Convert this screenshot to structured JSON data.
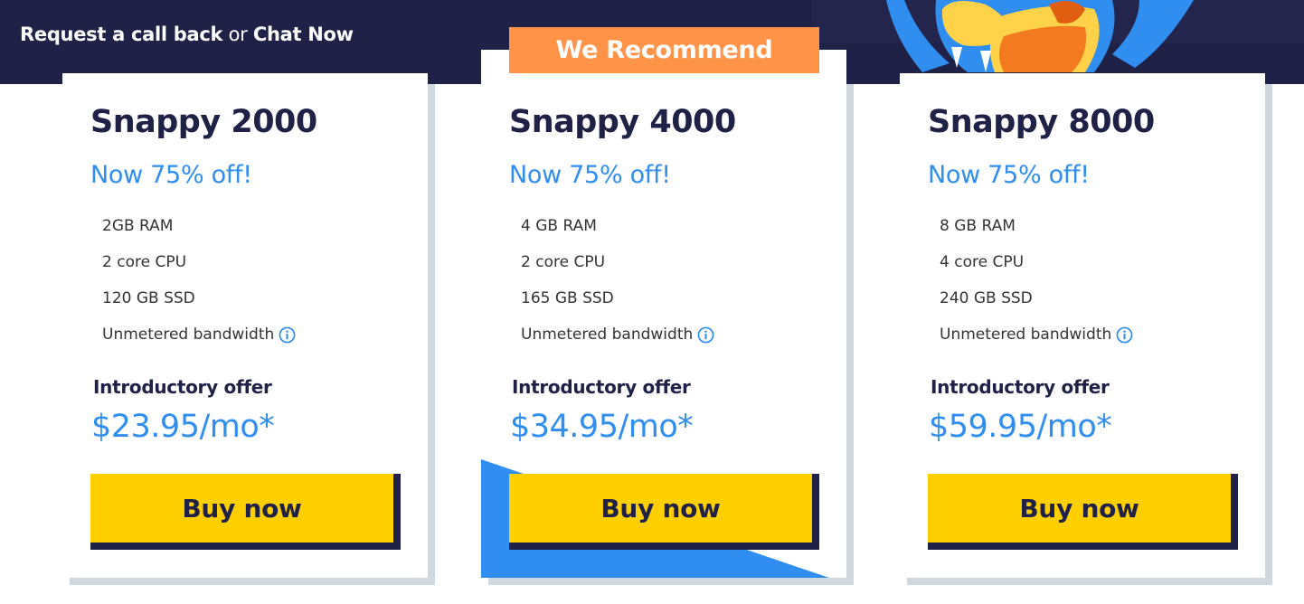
{
  "header": {
    "callback_label": "Request a call back",
    "or_label": "or",
    "chat_label": "Chat Now"
  },
  "recommend_badge": "We Recommend",
  "plans": [
    {
      "title": "Snappy 2000",
      "discount": "Now 75% off!",
      "features": [
        "2GB RAM",
        "2 core CPU",
        "120 GB SSD",
        "Unmetered bandwidth"
      ],
      "intro_label": "Introductory offer",
      "price": "$23.95/mo*",
      "button_label": "Buy now"
    },
    {
      "title": "Snappy 4000",
      "discount": "Now 75% off!",
      "features": [
        "4 GB RAM",
        "2 core CPU",
        "165 GB SSD",
        "Unmetered bandwidth"
      ],
      "intro_label": "Introductory offer",
      "price": "$34.95/mo*",
      "button_label": "Buy now"
    },
    {
      "title": "Snappy 8000",
      "discount": "Now 75% off!",
      "features": [
        "8 GB RAM",
        "4 core CPU",
        "240 GB SSD",
        "Unmetered bandwidth"
      ],
      "intro_label": "Introductory offer",
      "price": "$59.95/mo*",
      "button_label": "Buy now"
    }
  ],
  "icons": {
    "info": "info-circle-icon",
    "mascot": "gator-mascot"
  },
  "colors": {
    "navy": "#1f2146",
    "accent_blue": "#2f8ef0",
    "button_yellow": "#ffcf00",
    "recommend_orange": "#ff9448",
    "card_shadow": "#cfd8df"
  }
}
